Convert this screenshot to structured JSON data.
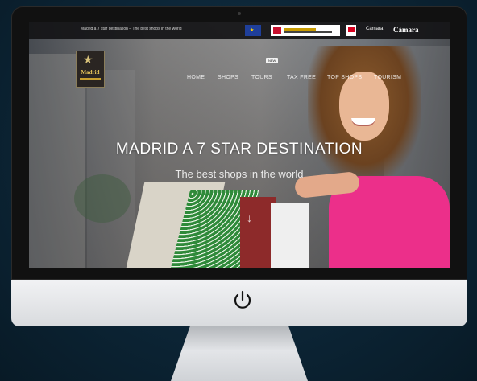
{
  "topbar": {
    "tagline": "Madrid a 7 star destination – The best shops in the world",
    "camara_small": "Cámara",
    "camara_large": "Cámara"
  },
  "site_logo": {
    "name": "Madrid"
  },
  "utility": {
    "new_badge": "NEW"
  },
  "nav": {
    "items": [
      "HOME",
      "SHOPS",
      "TOURS",
      "TAX FREE",
      "TOP SHOPS",
      "TOURISM"
    ]
  },
  "hero": {
    "title": "MADRID A 7 STAR DESTINATION",
    "subtitle": "The best shops in the world"
  },
  "icons": {
    "power": "power-icon",
    "scroll": "arrow-down-icon",
    "eu_flag": "eu-flag-icon",
    "logo_star": "star-icon"
  },
  "colors": {
    "accent_pink": "#ec2f8a",
    "logo_gold": "#e7c55a",
    "background": "#0c2536"
  }
}
